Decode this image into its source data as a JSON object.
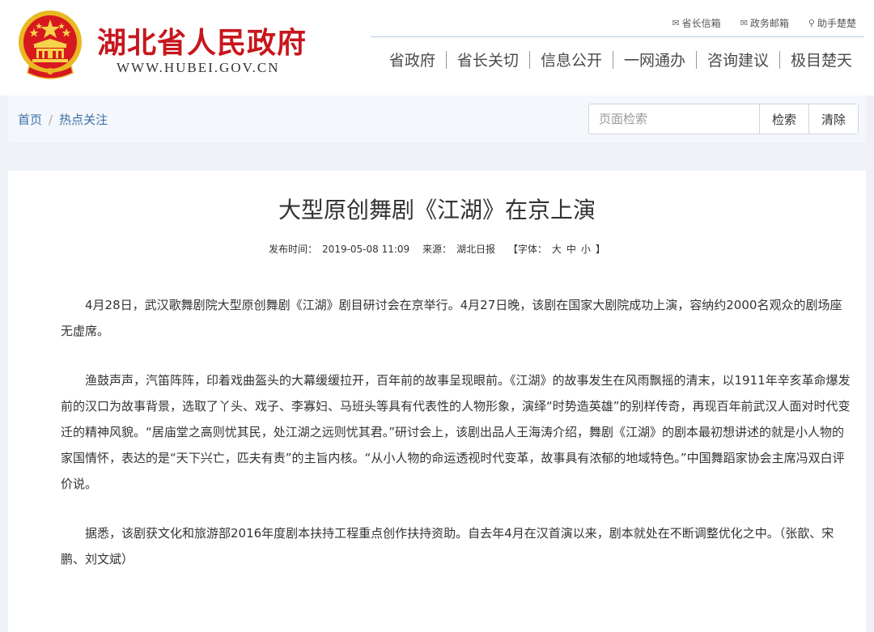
{
  "site": {
    "title": "湖北省人民政府",
    "url": "WWW.HUBEI.GOV.CN"
  },
  "utility_links": [
    {
      "label": "省长信箱",
      "icon": "mailbox-icon"
    },
    {
      "label": "政务邮箱",
      "icon": "envelope-icon"
    },
    {
      "label": "助手楚楚",
      "icon": "search-icon"
    }
  ],
  "nav": [
    "省政府",
    "省长关切",
    "信息公开",
    "一网通办",
    "咨询建议",
    "极目楚天"
  ],
  "breadcrumb": {
    "home": "首页",
    "separator": "/",
    "current": "热点关注"
  },
  "search": {
    "placeholder": "页面检索",
    "search_label": "检索",
    "clear_label": "清除"
  },
  "article": {
    "title": "大型原创舞剧《江湖》在京上演",
    "publish_label": "发布时间：",
    "publish_time": "2019-05-08 11:09",
    "source_label": "来源：",
    "source": "湖北日报",
    "font_open": "【字体：",
    "font_large": "大",
    "font_medium": "中",
    "font_small": "小",
    "font_close": "】",
    "paragraphs": [
      "4月28日，武汉歌舞剧院大型原创舞剧《江湖》剧目研讨会在京举行。4月27日晚，该剧在国家大剧院成功上演，容纳约2000名观众的剧场座无虚席。",
      "渔鼓声声，汽笛阵阵，印着戏曲盔头的大幕缓缓拉开，百年前的故事呈现眼前。《江湖》的故事发生在风雨飘摇的清末，以1911年辛亥革命爆发前的汉口为故事背景，选取了丫头、戏子、李寡妇、马班头等具有代表性的人物形象，演绎“时势造英雄”的别样传奇，再现百年前武汉人面对时代变迁的精神风貌。“居庙堂之高则忧其民，处江湖之远则忧其君。”研讨会上，该剧出品人王海涛介绍，舞剧《江湖》的剧本最初想讲述的就是小人物的家国情怀，表达的是“天下兴亡，匹夫有责”的主旨内核。“从小人物的命运透视时代变革，故事具有浓郁的地域特色。”中国舞蹈家协会主席冯双白评价说。",
      "据悉，该剧获文化和旅游部2016年度剧本扶持工程重点创作扶持资助。自去年4月在汉首演以来，剧本就处在不断调整优化之中。（张歆、宋鹏、刘文斌）"
    ]
  },
  "colors": {
    "brand_red": "#c8161d",
    "emblem_gold": "#f1c232",
    "link_blue": "#3a6fa8"
  }
}
